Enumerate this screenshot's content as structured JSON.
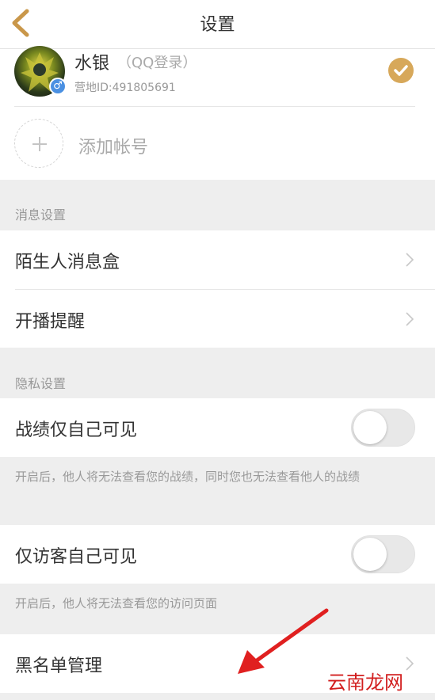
{
  "header": {
    "title": "设置"
  },
  "account": {
    "name": "水银",
    "login_type": "（QQ登录）",
    "camp_id": "营地ID:491805691",
    "gender_symbol": "♂"
  },
  "add_account": {
    "label": "添加帐号"
  },
  "message_settings": {
    "section_title": "消息设置",
    "items": [
      {
        "label": "陌生人消息盒"
      },
      {
        "label": "开播提醒"
      }
    ]
  },
  "privacy_settings": {
    "section_title": "隐私设置",
    "record_visible": {
      "label": "战绩仅自己可见",
      "enabled": false
    },
    "record_hint": "开启后，他人将无法查看您的战绩，同时您也无法查看他人的战绩",
    "visitor_visible": {
      "label": "仅访客自己可见",
      "enabled": false
    },
    "visitor_hint": "开启后，他人将无法查看您的访问页面"
  },
  "blacklist": {
    "label": "黑名单管理"
  },
  "watermark": "云南龙网",
  "colors": {
    "accent": "#d7a85a",
    "back_arrow": "#c9974a",
    "annotation_arrow": "#e02020",
    "background": "#eeeeee"
  }
}
